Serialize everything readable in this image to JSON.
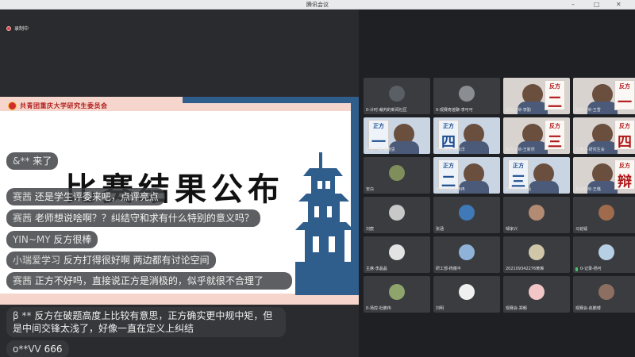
{
  "window": {
    "title": "腾讯会议"
  },
  "recording": {
    "label": "录制中"
  },
  "slide": {
    "org": "共青团重庆大学研究生委员会",
    "title": "比赛结果公布"
  },
  "chat": [
    {
      "name": "&**",
      "text": "来了"
    },
    {
      "name": "赛茜",
      "text": "还是学生评委来吧，点评亮点"
    },
    {
      "name": "赛茜",
      "text": "老师想说啥啊？？纠结守和求有什么特别的意义吗？"
    },
    {
      "name": "YIN~MY",
      "text": "反方很棒"
    },
    {
      "name": "小瑞爱学习",
      "text": "反方打得很好啊 两边都有讨论空间"
    },
    {
      "name": "赛茜",
      "text": "正方不好吗，直接说正方是消极的，似乎就很不合理了"
    },
    {
      "name": "β **",
      "text": "反方在破题高度上比较有意思，正方确实更中规中矩，但是中间交锋太浅了，好像一直在定义上纠结"
    },
    {
      "name": "o**VV",
      "text": "666"
    }
  ],
  "participants": [
    {
      "label": "0-计时-裁判的新闻社区",
      "kind": "avatar",
      "color": "#5a5f66"
    },
    {
      "label": "0-观赛奇迹聊-李可可",
      "kind": "avatar",
      "color": "#8a8d91"
    },
    {
      "label": "反方二辩-李勤",
      "kind": "video",
      "board": [
        "反方",
        "二"
      ],
      "theme": "red"
    },
    {
      "label": "反方一辩-王雪",
      "kind": "video",
      "board": [
        "反方",
        "一"
      ],
      "theme": "red"
    },
    {
      "label": "正方一辩-潘雅思",
      "kind": "video",
      "board": [
        "正方",
        "一"
      ],
      "theme": "blue"
    },
    {
      "label": "正方四辩-高俊洋",
      "kind": "video",
      "board": [
        "正方",
        "四"
      ],
      "theme": "blue"
    },
    {
      "label": "反方三辩-王新然",
      "kind": "video",
      "board": [
        "反方",
        "三"
      ],
      "theme": "red"
    },
    {
      "label": "王梓人-研究生会",
      "kind": "video",
      "board": [
        "反方",
        "四"
      ],
      "theme": "red"
    },
    {
      "label": "安白",
      "kind": "avatar",
      "color": "#7f8e5a"
    },
    {
      "label": "正方二辩-曹冉冉",
      "kind": "video",
      "board": [
        "正方",
        "二"
      ],
      "theme": "blue"
    },
    {
      "label": "正方三辩-孙涵",
      "kind": "video",
      "board": [
        "正方",
        "三"
      ],
      "theme": "blue"
    },
    {
      "label": "反方四辩-王璐",
      "kind": "video",
      "board": [
        "反方",
        "辩"
      ],
      "theme": "red"
    },
    {
      "label": "刘宸",
      "kind": "avatar",
      "color": "#c8c8c8"
    },
    {
      "label": "张涵",
      "kind": "avatar",
      "color": "#3f79b8"
    },
    {
      "label": "邹家兴",
      "kind": "avatar",
      "color": "#b38b73"
    },
    {
      "label": "马铭镭",
      "kind": "avatar",
      "color": "#a06a4d"
    },
    {
      "label": "主席-李晶晶",
      "kind": "avatar",
      "color": "#e3e3e3"
    },
    {
      "label": "研工部-杨蕴平",
      "kind": "avatar",
      "color": "#8fb3d8"
    },
    {
      "label": "202109342276黄琳",
      "kind": "avatar",
      "color": "#cfc7a8"
    },
    {
      "label": "0-记录-杨可",
      "kind": "avatar",
      "color": "#b7cfe3",
      "mic": true
    },
    {
      "label": "0-场控-杜鹏伟",
      "kind": "avatar",
      "color": "#8fa36d"
    },
    {
      "label": "刘明",
      "kind": "avatar",
      "color": "#f0f0f0"
    },
    {
      "label": "观赛会-郑朝",
      "kind": "avatar",
      "color": "#f2c6c6"
    },
    {
      "label": "观赛会-赵鹏博",
      "kind": "avatar",
      "color": "#8d6f62"
    }
  ]
}
